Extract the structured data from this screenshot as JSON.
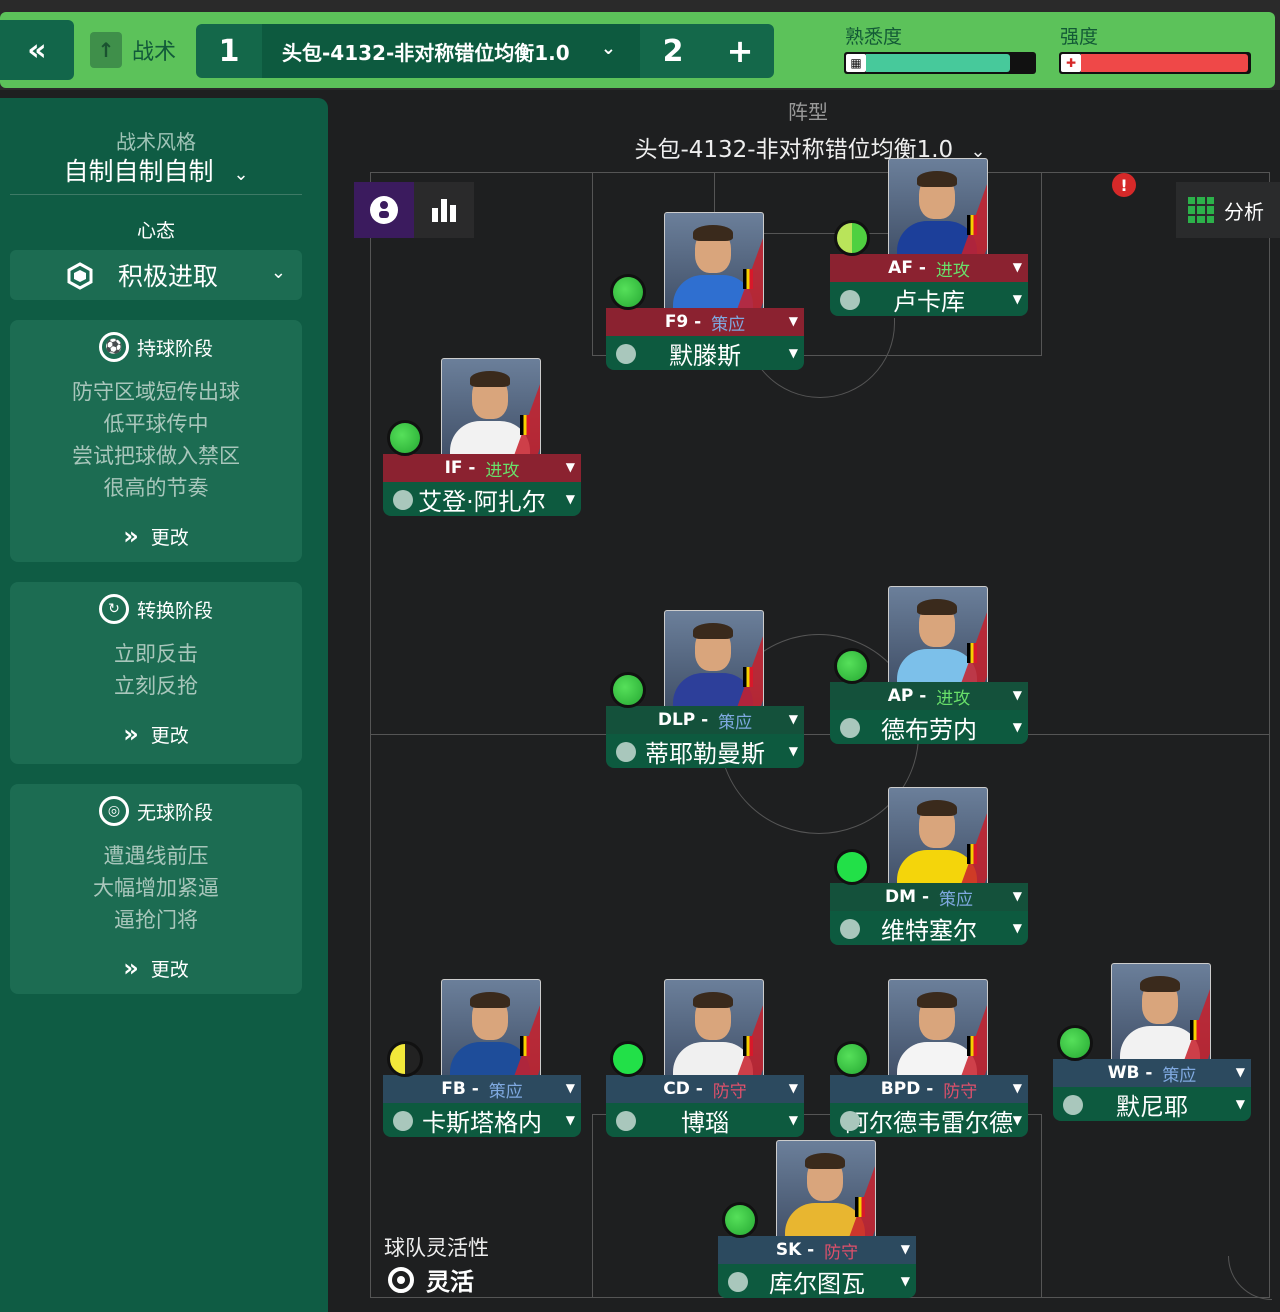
{
  "header": {
    "tactics_label": "战术",
    "slot1": "1",
    "slot2": "2",
    "add": "+",
    "tactic_name": "头包-4132-非对称错位均衡1.0",
    "familiarity_label": "熟悉度",
    "intensity_label": "强度",
    "familiarity_level": 0.76,
    "intensity_level": 0.88
  },
  "sidebar": {
    "style_label": "战术风格",
    "style_value": "自制自制自制",
    "mentality_label": "心态",
    "mentality_value": "积极进取",
    "phases": [
      {
        "title": "持球阶段",
        "lines": [
          "防守区域短传出球",
          "低平球传中",
          "尝试把球做入禁区",
          "很高的节奏"
        ],
        "change": "更改"
      },
      {
        "title": "转换阶段",
        "lines": [
          "立即反击",
          "立刻反抢"
        ],
        "change": "更改"
      },
      {
        "title": "无球阶段",
        "lines": [
          "遭遇线前压",
          "大幅增加紧逼",
          "逼抢门将"
        ],
        "change": "更改"
      }
    ]
  },
  "pitch": {
    "formation_label": "阵型",
    "formation_value": "头包-4132-非对称错位均衡1.0",
    "analysis_label": "分析",
    "flexibility_label": "球队灵活性",
    "flexibility_value": "灵活"
  },
  "players": [
    {
      "role": "F9",
      "duty": "策应",
      "duty_type": "support",
      "role_bg": "attack",
      "name": "默滕斯",
      "status": "green",
      "shirt": "#2f6fd0"
    },
    {
      "role": "AF",
      "duty": "进攻",
      "duty_type": "attack",
      "role_bg": "attack",
      "name": "卢卡库",
      "status": "lime",
      "shirt": "#1c3f9a"
    },
    {
      "role": "IF",
      "duty": "进攻",
      "duty_type": "attack",
      "role_bg": "attack",
      "name": "艾登·阿扎尔",
      "status": "green",
      "shirt": "#f2f2f2"
    },
    {
      "role": "DLP",
      "duty": "策应",
      "duty_type": "support",
      "role_bg": "support",
      "name": "蒂耶勒曼斯",
      "status": "green",
      "shirt": "#2d3f9a"
    },
    {
      "role": "AP",
      "duty": "进攻",
      "duty_type": "attack",
      "role_bg": "support",
      "name": "德布劳内",
      "status": "green",
      "shirt": "#7cc0ea"
    },
    {
      "role": "DM",
      "duty": "策应",
      "duty_type": "support",
      "role_bg": "support",
      "name": "维特塞尔",
      "status": "bright",
      "shirt": "#f4d50b"
    },
    {
      "role": "FB",
      "duty": "策应",
      "duty_type": "support",
      "role_bg": "defend",
      "name": "卡斯塔格内",
      "status": "half",
      "shirt": "#1e4d9a"
    },
    {
      "role": "CD",
      "duty": "防守",
      "duty_type": "defend",
      "role_bg": "defend",
      "name": "博瑙",
      "status": "bright",
      "shirt": "#f0f0f0"
    },
    {
      "role": "BPD",
      "duty": "防守",
      "duty_type": "defend",
      "role_bg": "defend",
      "name": "阿尔德韦雷尔德",
      "status": "green",
      "shirt": "#f4f4f4"
    },
    {
      "role": "WB",
      "duty": "策应",
      "duty_type": "support",
      "role_bg": "defend",
      "name": "默尼耶",
      "status": "green",
      "shirt": "#f2f2f2"
    },
    {
      "role": "SK",
      "duty": "防守",
      "duty_type": "defend",
      "role_bg": "defend",
      "name": "库尔图瓦",
      "status": "green",
      "shirt": "#e8b630"
    }
  ],
  "colors": {
    "accent_green": "#5cc25a",
    "sidebar_bg": "#0f5c44",
    "status_green": "#2ecc40",
    "attack_duty": "#69e06a",
    "support_duty": "#7fa9e0",
    "defend_duty": "#e0506b"
  }
}
